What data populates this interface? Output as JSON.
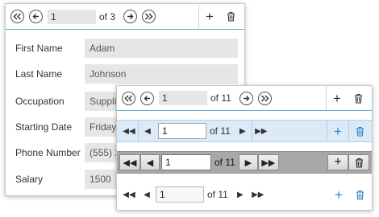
{
  "back_form": {
    "pager": {
      "first_icon": "double-chevron-left-icon",
      "prev_icon": "chevron-left-icon",
      "page_value": "1",
      "of_text": "of 3",
      "next_icon": "chevron-right-icon",
      "last_icon": "double-chevron-right-icon"
    },
    "actions": {
      "add_icon": "plus-icon",
      "delete_icon": "trash-icon"
    },
    "fields": [
      {
        "label": "First Name",
        "value": "Adam"
      },
      {
        "label": "Last Name",
        "value": "Johnson"
      },
      {
        "label": "Occupation",
        "value": "Supplier"
      },
      {
        "label": "Starting Date",
        "value": "Friday, July 14, 2006"
      },
      {
        "label": "Phone Number",
        "value": "(555) 2"
      },
      {
        "label": "Salary",
        "value": "1500"
      }
    ]
  },
  "front_panel": {
    "navigators": [
      {
        "style": "metro",
        "page_value": "1",
        "of_text": "of 11"
      },
      {
        "style": "office-blue",
        "page_value": "1",
        "of_text": "of 11"
      },
      {
        "style": "dark",
        "page_value": "1",
        "of_text": "of 11"
      },
      {
        "style": "light",
        "page_value": "1",
        "of_text": "of 11"
      }
    ]
  },
  "glyphs": {
    "first": "⯬",
    "prev": "←",
    "next": "→",
    "last": "⯮",
    "plus": "+",
    "trash": "🗑",
    "tri_first": "◀◀",
    "tri_prev": "◀",
    "tri_next": "▶",
    "tri_last": "▶▶"
  },
  "colors": {
    "accent_line": "#5ab5c4",
    "office_bar": "#dce9f6",
    "office_icon": "#2a7fc1",
    "dark_bar": "#a8a8a8"
  }
}
